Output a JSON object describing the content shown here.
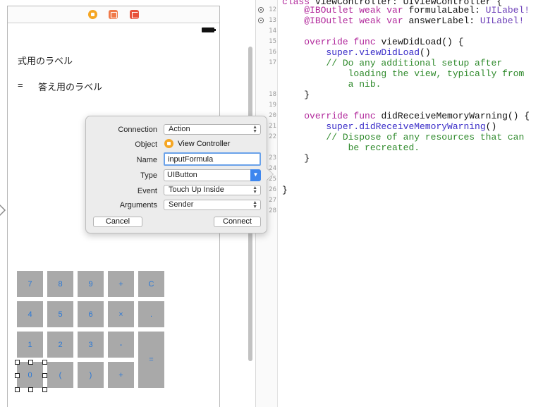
{
  "storyboard": {
    "formula_label": "式用のラベル",
    "answer_equals": "=",
    "answer_label": "答え用のラベル",
    "keys": [
      {
        "label": "7",
        "col": 0,
        "row": 0
      },
      {
        "label": "8",
        "col": 1,
        "row": 0
      },
      {
        "label": "9",
        "col": 2,
        "row": 0
      },
      {
        "label": "+",
        "col": 3,
        "row": 0
      },
      {
        "label": "C",
        "col": 4,
        "row": 0
      },
      {
        "label": "4",
        "col": 0,
        "row": 1
      },
      {
        "label": "5",
        "col": 1,
        "row": 1
      },
      {
        "label": "6",
        "col": 2,
        "row": 1
      },
      {
        "label": "×",
        "col": 3,
        "row": 1
      },
      {
        "label": ".",
        "col": 4,
        "row": 1
      },
      {
        "label": "1",
        "col": 0,
        "row": 2
      },
      {
        "label": "2",
        "col": 1,
        "row": 2
      },
      {
        "label": "3",
        "col": 2,
        "row": 2
      },
      {
        "label": "-",
        "col": 3,
        "row": 2
      },
      {
        "label": "=",
        "col": 4,
        "row": 2,
        "tall": true
      },
      {
        "label": "0",
        "col": 0,
        "row": 3,
        "selected": true
      },
      {
        "label": "(",
        "col": 1,
        "row": 3
      },
      {
        "label": ")",
        "col": 2,
        "row": 3
      },
      {
        "label": "+",
        "col": 3,
        "row": 3
      }
    ]
  },
  "popover": {
    "connection_label": "Connection",
    "connection_value": "Action",
    "object_label": "Object",
    "object_value": "View Controller",
    "name_label": "Name",
    "name_value": "inputFormula",
    "type_label": "Type",
    "type_value": "UIButton",
    "event_label": "Event",
    "event_value": "Touch Up Inside",
    "arguments_label": "Arguments",
    "arguments_value": "Sender",
    "cancel_label": "Cancel",
    "connect_label": "Connect"
  },
  "editor": {
    "line_numbers": [
      "12",
      "13",
      "14",
      "15",
      "16",
      "17",
      "18",
      "19",
      "20",
      "21",
      "22",
      "23",
      "24",
      "25",
      "26",
      "27",
      "28"
    ],
    "lines": [
      {
        "kw": "class ",
        "rest": "ViewController: UIViewController {"
      },
      {
        "kw": "@IBOutlet weak var ",
        "rest": "formulaLabel: ",
        "ty": "UILabel!"
      },
      {
        "kw": "@IBOutlet weak var ",
        "rest": "answerLabel: ",
        "ty": "UILabel!"
      },
      {
        "kw": "override func ",
        "rest": "viewDidLoad() {"
      },
      {
        "fn": "super.viewDidLoad",
        "rest": "()"
      },
      {
        "cm": "// Do any additional setup after"
      },
      {
        "cm": "loading the view, typically from"
      },
      {
        "cm": "a nib."
      },
      {
        "rest": "}"
      },
      {
        "kw": "override func ",
        "rest": "didReceiveMemoryWarning() {"
      },
      {
        "fn": "super.didReceiveMemoryWarning",
        "rest": "()"
      },
      {
        "cm": "// Dispose of any resources that can"
      },
      {
        "cm": "be recreated."
      },
      {
        "rest": "}"
      },
      {
        "rest": "}"
      }
    ]
  },
  "colors": {
    "keyword": "#b1289b",
    "type": "#6c3fb8",
    "comment": "#2f8a2c",
    "key_text": "#2a78d6",
    "key_bg": "#a9a9a9",
    "accent": "#3d86ee"
  }
}
